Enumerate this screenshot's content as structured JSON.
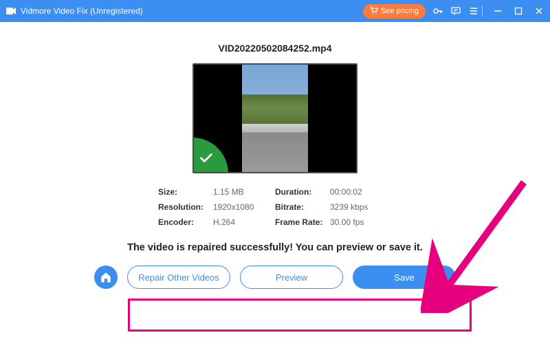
{
  "titlebar": {
    "app_name": "Vidmore Video Fix (Unregistered)",
    "see_pricing": "See pricing"
  },
  "main": {
    "filename": "VID20220502084252.mp4",
    "info": {
      "size_label": "Size:",
      "size_value": "1.15 MB",
      "duration_label": "Duration:",
      "duration_value": "00:00:02",
      "resolution_label": "Resolution:",
      "resolution_value": "1920x1080",
      "bitrate_label": "Bitrate:",
      "bitrate_value": "3239 kbps",
      "encoder_label": "Encoder:",
      "encoder_value": "H.264",
      "framerate_label": "Frame Rate:",
      "framerate_value": "30.00 fps"
    },
    "success_message": "The video is repaired successfully! You can preview or save it."
  },
  "buttons": {
    "repair_other": "Repair Other Videos",
    "preview": "Preview",
    "save": "Save"
  },
  "colors": {
    "primary": "#3c8ef0",
    "accent": "#ff7a3d",
    "success": "#2a9a3e",
    "highlight": "#e6007e"
  }
}
